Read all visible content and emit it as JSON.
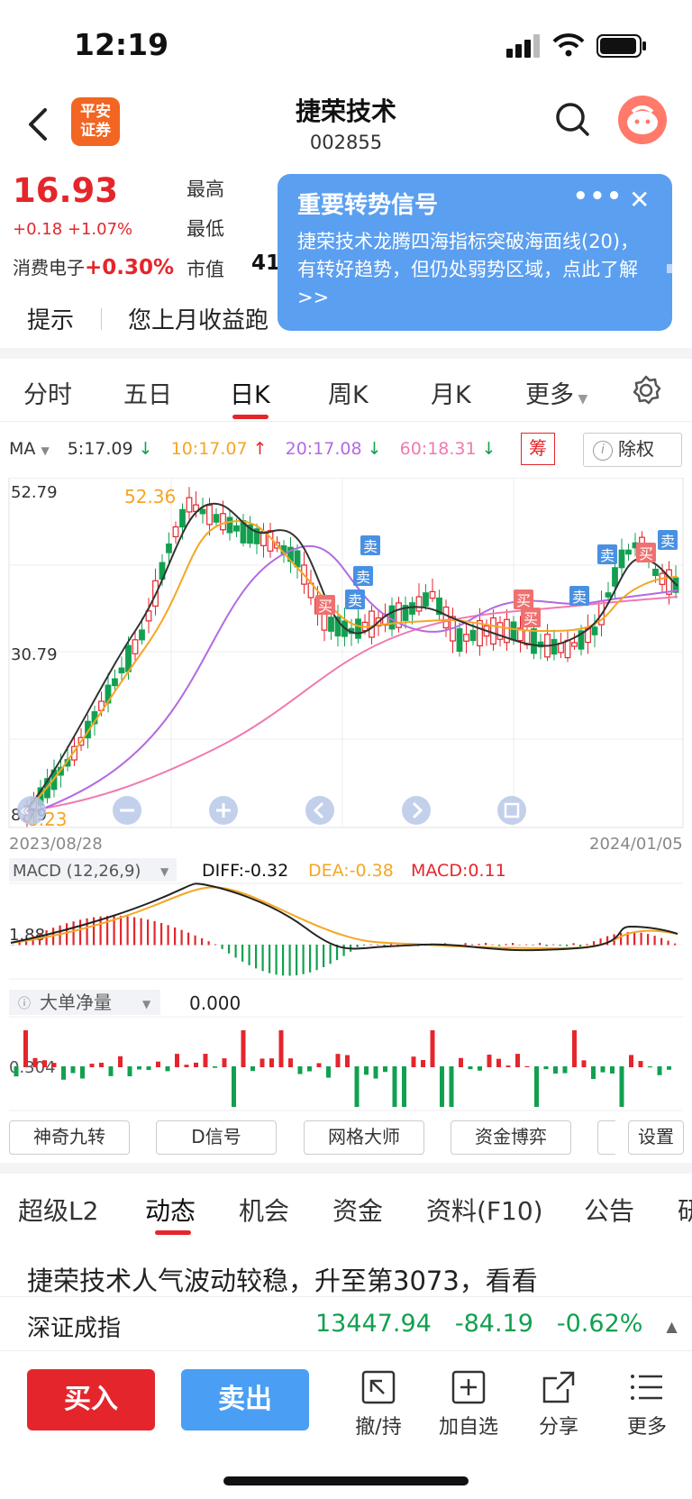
{
  "status_bar": {
    "time": "12:19"
  },
  "header": {
    "title": "捷荣技术",
    "code": "002855",
    "broker_logo": "平安证券"
  },
  "quote": {
    "price": "16.93",
    "change": "+0.18 +1.07%",
    "sector_name": "消费电子",
    "sector_change": "+0.30%",
    "high_label": "最高",
    "low_label": "最低",
    "cap_label": "市值",
    "cap_value_partial": "41"
  },
  "signal_popup": {
    "title": "重要转势信号",
    "more": "•••",
    "close": "✕",
    "body": "捷荣技术龙腾四海指标突破海面线(20)，有转好趋势，但仍处弱势区域，点此了解>>"
  },
  "tip": {
    "label": "提示",
    "text": "您上月收益跑"
  },
  "period_tabs": [
    "分时",
    "五日",
    "日K",
    "周K",
    "月K",
    "更多"
  ],
  "active_period": "日K",
  "ma_row": {
    "indicator": "MA",
    "ma5": "5:17.09",
    "ma10": "10:17.07",
    "ma20": "20:17.08",
    "ma60": "60:18.31",
    "chip_button": "筹",
    "exright_button": "除权"
  },
  "kline": {
    "max_label": "52.79",
    "mid_label": "30.79",
    "min_label": "8.79",
    "high_mark": "52.36",
    "low_mark": "8.23",
    "start_date": "2023/08/28",
    "end_date": "2024/01/05"
  },
  "macd": {
    "name": "MACD (12,26,9)",
    "diff": "DIFF:-0.32",
    "dea": "DEA:-0.38",
    "macd": "MACD:0.11",
    "axis_label": "1.88"
  },
  "net_flow": {
    "name": "大单净量",
    "value": "0.000",
    "axis_label": "0.304"
  },
  "tools": [
    "神奇九转",
    "D信号",
    "网格大师",
    "资金博弈",
    "设置"
  ],
  "section_tabs": [
    "超级L2",
    "动态",
    "机会",
    "资金",
    "资料(F10)",
    "公告",
    "研"
  ],
  "active_section": "动态",
  "news_headline": "捷荣技术人气波动较稳，升至第3073，看看",
  "index_ticker": {
    "name": "深证成指",
    "value": "13447.94",
    "change": "-84.19",
    "pct": "-0.62%"
  },
  "bottom_bar": {
    "buy": "买入",
    "sell": "卖出",
    "actions": [
      "撤/持",
      "加自选",
      "分享",
      "更多"
    ]
  },
  "colors": {
    "up": "#e4262c",
    "down": "#12a050",
    "accent_blue": "#4a90e2",
    "ma5": "#333333",
    "ma10": "#f5a623",
    "ma20": "#b36ae2",
    "ma60": "#f07ab0"
  }
}
